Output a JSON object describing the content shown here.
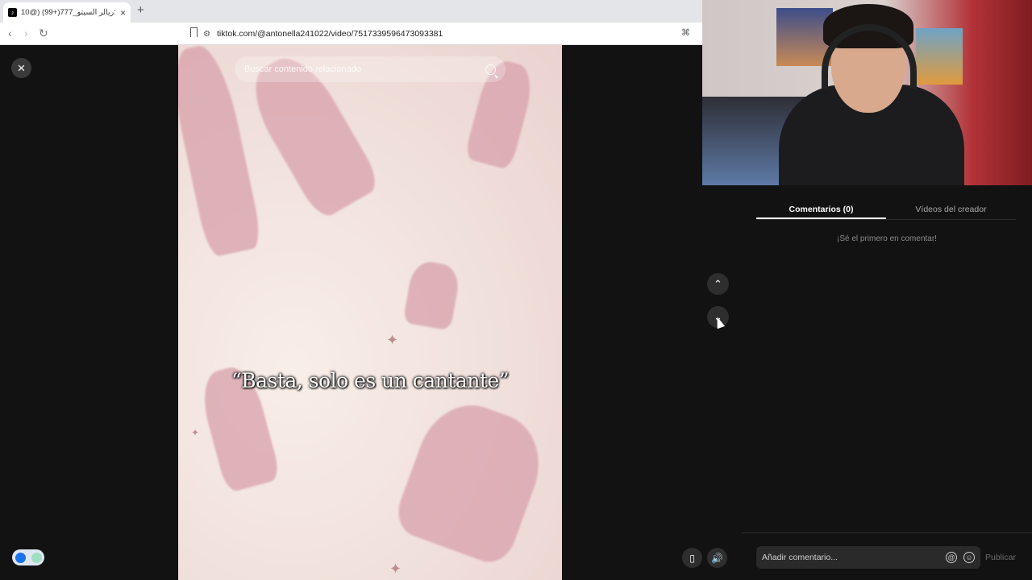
{
  "browser": {
    "tab_title": "ريالر السيتو_777(+99) (@10:",
    "url": "tiktok.com/@antonella241022/video/7517339596473093381",
    "new_tab_symbol": "+",
    "close_tab_symbol": "×"
  },
  "video": {
    "search_placeholder": "Buscar contenido relacionado",
    "caption": "“Basta, solo es un cantante”"
  },
  "panel": {
    "tabs": [
      {
        "label": "Comentarios (0)",
        "active": true
      },
      {
        "label": "Vídeos del creador",
        "active": false
      }
    ],
    "empty_message": "¡Sé el primero en comentar!",
    "comment_placeholder": "Añadir comentario...",
    "publish_label": "Publicar"
  },
  "icons": {
    "close": "×",
    "up": "⌃",
    "down": "⌄",
    "volume": "🔊",
    "mention": "@",
    "emoji": "☺"
  },
  "colors": {
    "background": "#121212",
    "video_tint": "#d8a1ab",
    "accent_blue": "#1a73e8"
  }
}
